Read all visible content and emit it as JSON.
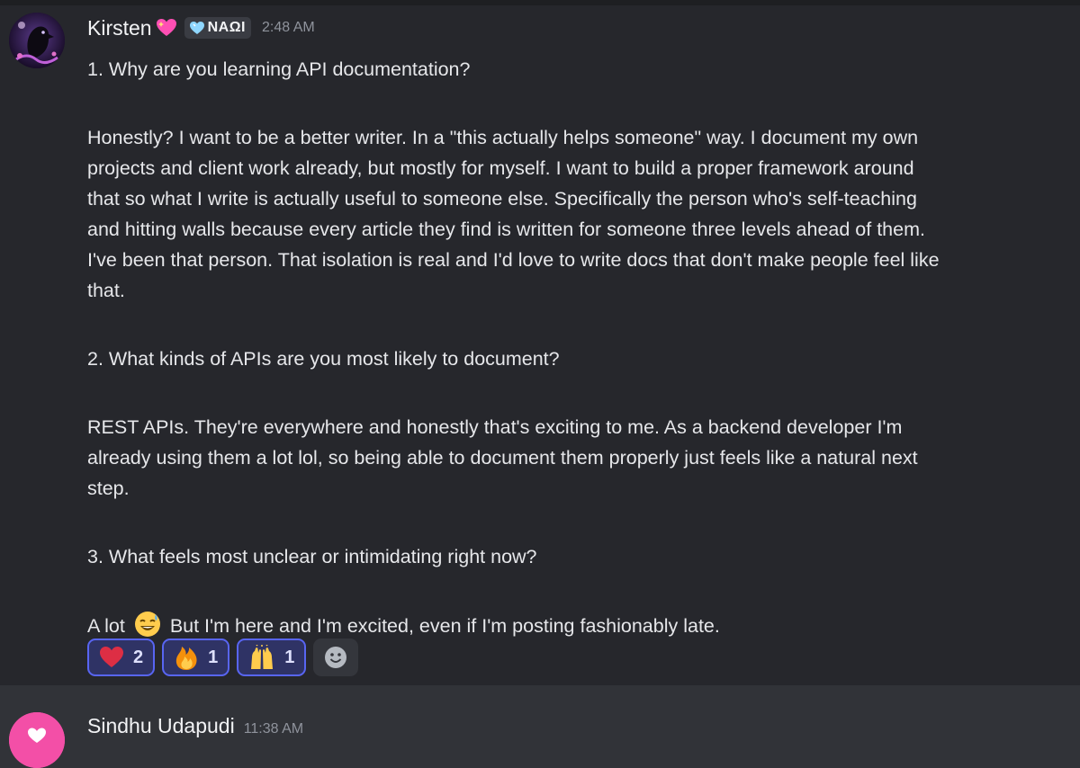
{
  "message": {
    "author": "Kirsten",
    "role_tag": "NAΩI",
    "timestamp": "2:48 AM",
    "lines": [
      "1. Why are you learning API documentation?",
      "Honestly? I want to be a better writer. In a \"this actually helps someone\" way. I document my own",
      "projects and client work already, but mostly for myself. I want to build a proper framework around",
      "that so what I write is actually useful to someone else. Specifically the person who's self-teaching",
      "and hitting walls because every article they find is written for someone three levels ahead of them.",
      "I've been that person. That isolation is real and I'd love to write docs that don't make people feel like",
      "that.",
      "2. What kinds of APIs are you most likely to document?",
      "REST APIs. They're everywhere and honestly that's exciting to me. As a backend developer I'm",
      "already using them a lot lol, so being able to document them properly just feels like a natural next",
      "step.",
      "3. What feels most unclear or intimidating right now?"
    ],
    "last_line_before": "A lot",
    "last_line_after": "But I'm here and I'm excited, even if I'm posting fashionably late.",
    "inline_emoji": "sweat-smile-emoji",
    "reactions": [
      {
        "emoji": "heart-emoji",
        "count": "2"
      },
      {
        "emoji": "fire-emoji",
        "count": "1"
      },
      {
        "emoji": "raised-hands-emoji",
        "count": "1"
      }
    ],
    "add_reaction_icon": "smiley-add-reaction-icon"
  },
  "next_message": {
    "author": "Sindhu Udapudi",
    "timestamp": "11:38 AM"
  },
  "colors": {
    "background": "#313338",
    "message_highlight": "#26272c",
    "reaction_bg": "#2f3365",
    "reaction_border": "#5865f2"
  }
}
